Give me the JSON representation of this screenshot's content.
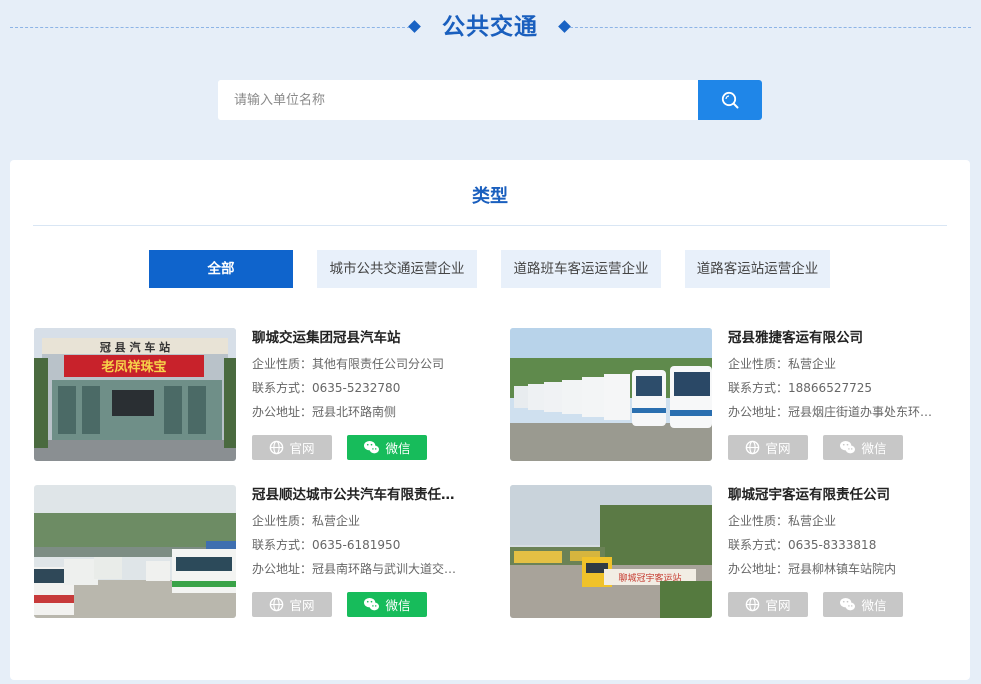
{
  "header": {
    "title": "公共交通"
  },
  "search": {
    "placeholder": "请输入单位名称",
    "value": ""
  },
  "section": {
    "title": "类型"
  },
  "tabs": [
    {
      "label": "全部",
      "active": true
    },
    {
      "label": "城市公共交通运营企业",
      "active": false
    },
    {
      "label": "道路班车客运运营企业",
      "active": false
    },
    {
      "label": "道路客运站运营企业",
      "active": false
    }
  ],
  "labels": {
    "nature": "企业性质：",
    "contact": "联系方式：",
    "address": "办公地址：",
    "website": "官网",
    "wechat": "微信"
  },
  "companies": [
    {
      "name": "聊城交运集团冠县汽车站",
      "nature": "其他有限责任公司分公司",
      "phone": "0635-5232780",
      "address": "冠县北环路南侧",
      "wechat_active": true,
      "photo_sign": "冠 县 汽 车 站",
      "photo_banner": "老凤祥珠宝"
    },
    {
      "name": "冠县雅捷客运有限公司",
      "nature": "私营企业",
      "phone": "18866527725",
      "address": "冠县烟庄街道办事处东环路…",
      "wechat_active": false
    },
    {
      "name": "冠县顺达城市公共汽车有限责任…",
      "nature": "私营企业",
      "phone": "0635-6181950",
      "address": "冠县南环路与武训大道交叉…",
      "wechat_active": true
    },
    {
      "name": "聊城冠宇客运有限责任公司",
      "nature": "私营企业",
      "phone": "0635-8333818",
      "address": "冠县柳林镇车站院内",
      "wechat_active": false,
      "photo_sign": "聊城冠宇客运站"
    }
  ],
  "colors": {
    "accent": "#0f64cc",
    "search_button": "#1f86e8",
    "wechat_green": "#17bc5b",
    "disabled_gray": "#c7c7c7",
    "page_bg": "#e6eef8"
  }
}
